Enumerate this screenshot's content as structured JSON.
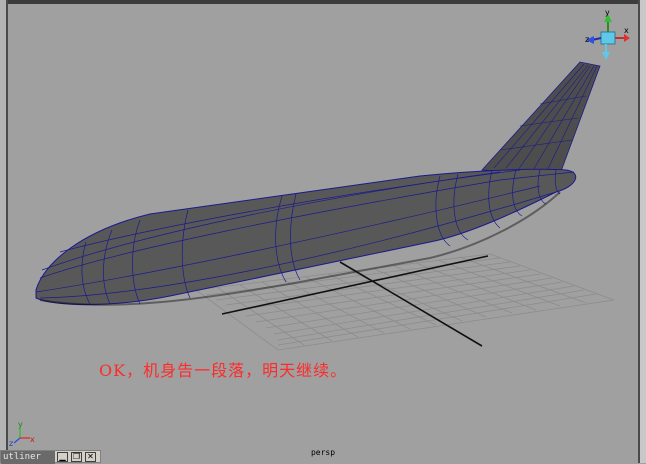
{
  "viewport": {
    "camera": "persp",
    "annotation": "OK，机身告一段落，明天继续。"
  },
  "view_cube": {
    "label_x": "x",
    "label_y": "y",
    "label_z": "z"
  },
  "corner_axis": {
    "label_x": "x",
    "label_y": "y",
    "label_z": "z"
  },
  "outliner": {
    "title": "utliner",
    "minimize_icon": "minimize-icon",
    "restore_icon": "restore-icon",
    "close_icon": "close-icon"
  },
  "colors": {
    "viewport_bg": "#a0a0a0",
    "wireframe": "#1a1a8c",
    "annotation": "#ff2a2a",
    "axis_x": "#e03030",
    "axis_y": "#30c030",
    "axis_z": "#3050e0"
  }
}
